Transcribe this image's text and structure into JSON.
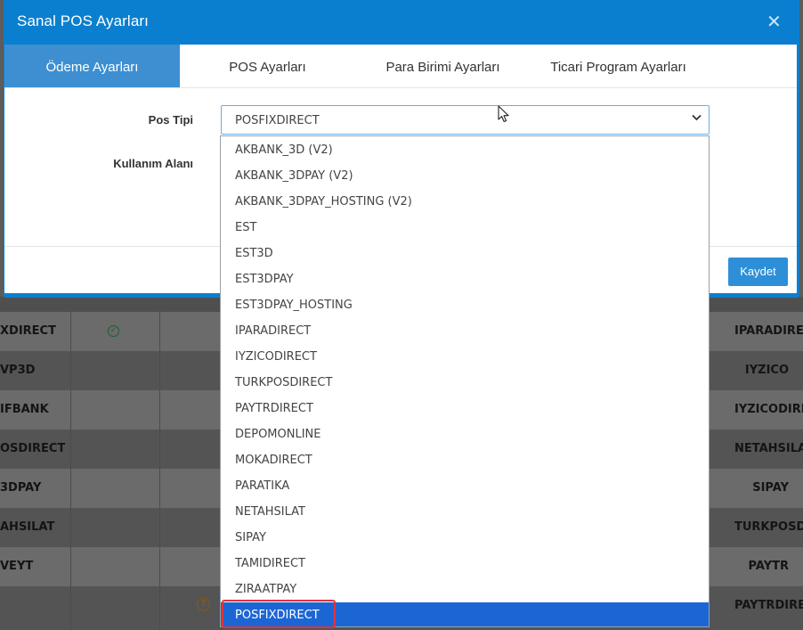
{
  "modal": {
    "title": "Sanal POS Ayarları",
    "close_symbol": "✕",
    "tabs": [
      {
        "label": "Ödeme Ayarları",
        "active": true
      },
      {
        "label": "POS Ayarları",
        "active": false
      },
      {
        "label": "Para Birimi Ayarları",
        "active": false
      },
      {
        "label": "Ticari Program Ayarları",
        "active": false
      }
    ],
    "form": {
      "pos_tipi_label": "Pos Tipi",
      "pos_tipi_value": "POSFIXDIRECT",
      "kullanim_alani_label": "Kullanım Alanı"
    },
    "save_label": "Kaydet"
  },
  "dropdown": {
    "options": [
      "AKBANK_3D (V2)",
      "AKBANK_3DPAY (V2)",
      "AKBANK_3DPAY_HOSTING (V2)",
      "EST",
      "EST3D",
      "EST3DPAY",
      "EST3DPAY_HOSTING",
      "IPARADIRECT",
      "IYZICODIRECT",
      "TURKPOSDIRECT",
      "PAYTRDIRECT",
      "DEPOMONLINE",
      "MOKADIRECT",
      "PARATIKA",
      "NETAHSILAT",
      "SIPAY",
      "TAMIDIRECT",
      "ZIRAATPAY",
      "POSFIXDIRECT"
    ],
    "selected": "POSFIXDIRECT"
  },
  "background_table": {
    "rows": [
      {
        "left": "XDIRECT",
        "right": "IPARADIRECT",
        "icon": "check"
      },
      {
        "left": "VP3D",
        "right": "IYZICO",
        "icon": ""
      },
      {
        "left": "IFBANK",
        "right": "IYZICODIRECT",
        "icon": ""
      },
      {
        "left": "OSDIRECT",
        "right": "NETAHSILAT",
        "icon": ""
      },
      {
        "left": "3DPAY",
        "right": "SIPAY",
        "icon": ""
      },
      {
        "left": "AHSILAT",
        "right": "TURKPOSDIRECT",
        "icon": ""
      },
      {
        "left": "VEYT",
        "right": "PAYTR",
        "icon": ""
      },
      {
        "left": "",
        "right": "PAYTRDIRECT",
        "icon": "question"
      }
    ]
  },
  "colors": {
    "modal_header": "#0b7fcf",
    "active_tab": "#3d8fd1",
    "selected_option": "#1c66d4",
    "highlight_box": "#e2333b",
    "save_button": "#2d8fd8"
  }
}
